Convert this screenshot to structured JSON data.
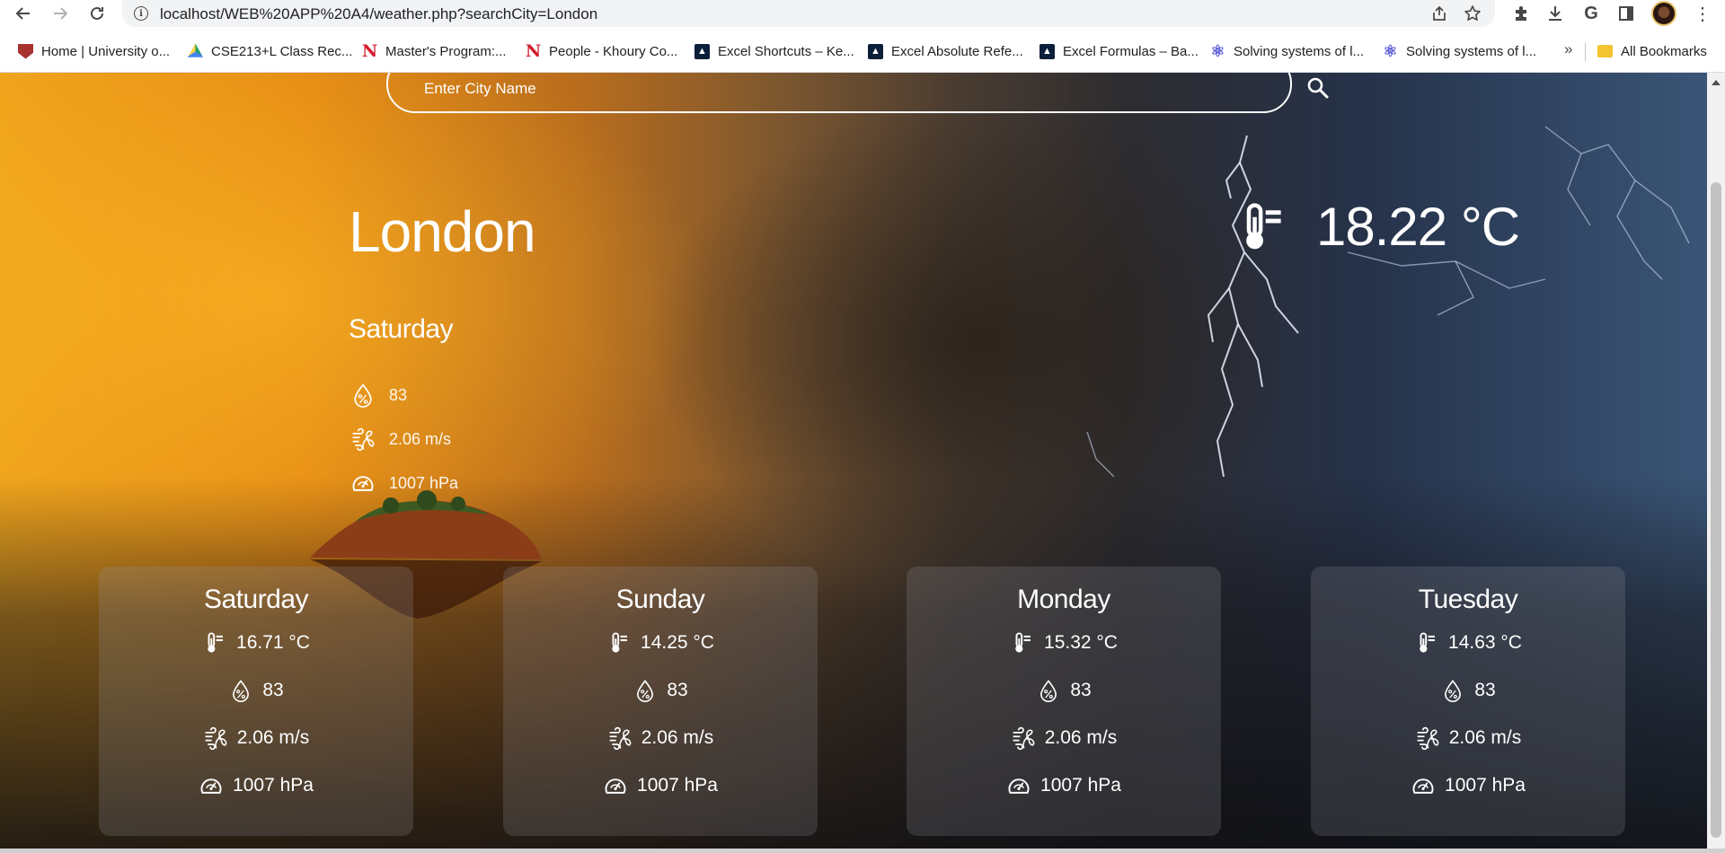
{
  "browser": {
    "url": "localhost/WEB%20APP%20A4/weather.php?searchCity=London",
    "bookmarks": [
      {
        "label": "Home | University o...",
        "icon": "university-icon"
      },
      {
        "label": "CSE213+L Class Rec...",
        "icon": "google-drive-icon"
      },
      {
        "label": "Master's Program:...",
        "icon": "northeastern-icon"
      },
      {
        "label": "People - Khoury Co...",
        "icon": "northeastern-icon"
      },
      {
        "label": "Excel Shortcuts – Ke...",
        "icon": "excel-site-icon"
      },
      {
        "label": "Excel Absolute Refe...",
        "icon": "excel-site-icon"
      },
      {
        "label": "Excel Formulas – Ba...",
        "icon": "excel-site-icon"
      },
      {
        "label": "Solving systems of l...",
        "icon": "atom-icon"
      },
      {
        "label": "Solving systems of l...",
        "icon": "atom-icon"
      }
    ],
    "more_bookmarks": "»",
    "all_bookmarks_label": "All Bookmarks"
  },
  "search": {
    "placeholder": "Enter City Name"
  },
  "current": {
    "city": "London",
    "day": "Saturday",
    "humidity": "83",
    "wind": "2.06 m/s",
    "pressure": "1007 hPa",
    "temperature": "18.22 °C"
  },
  "forecast": [
    {
      "day": "Saturday",
      "temperature": "16.71 °C",
      "humidity": "83",
      "wind": "2.06 m/s",
      "pressure": "1007 hPa"
    },
    {
      "day": "Sunday",
      "temperature": "14.25 °C",
      "humidity": "83",
      "wind": "2.06 m/s",
      "pressure": "1007 hPa"
    },
    {
      "day": "Monday",
      "temperature": "15.32 °C",
      "humidity": "83",
      "wind": "2.06 m/s",
      "pressure": "1007 hPa"
    },
    {
      "day": "Tuesday",
      "temperature": "14.63 °C",
      "humidity": "83",
      "wind": "2.06 m/s",
      "pressure": "1007 hPa"
    }
  ]
}
